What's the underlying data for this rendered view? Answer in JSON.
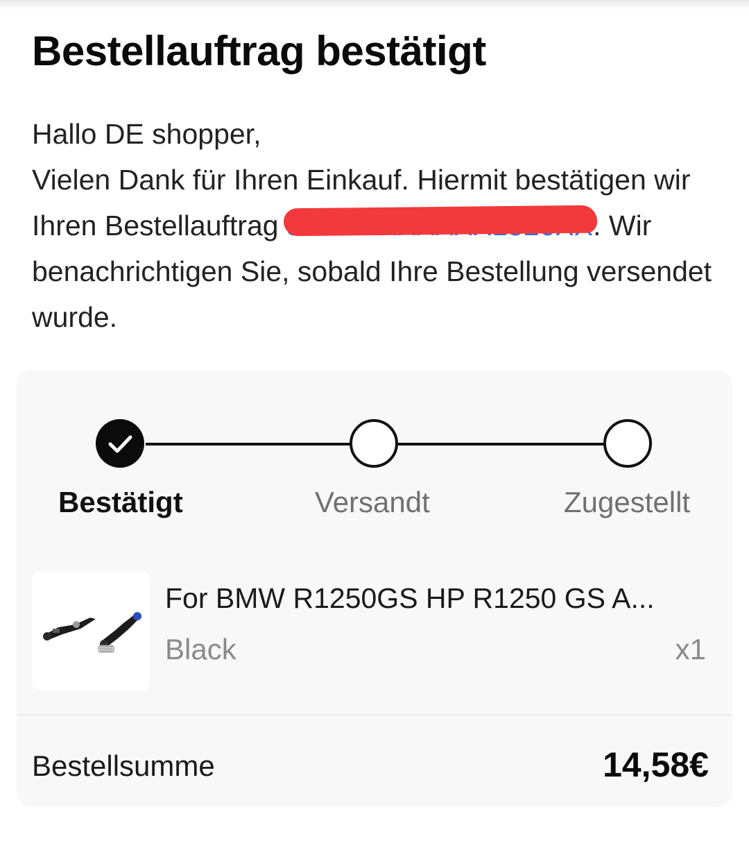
{
  "header": {
    "title": "Bestellauftrag bestätigt"
  },
  "message": {
    "greeting": "Hallo DE shopper,",
    "line_before_order": "Vielen Dank für Ihren Einkauf. Hiermit bestätigen wir Ihren Bestellauftrag ",
    "line_after_order": ". Wir benachrichtigen Sie, sobald Ihre Bestellung versendet wurde."
  },
  "tracker": {
    "steps": [
      {
        "label": "Bestätigt",
        "state": "done"
      },
      {
        "label": "Versandt",
        "state": "pending"
      },
      {
        "label": "Zugestellt",
        "state": "pending"
      }
    ]
  },
  "item": {
    "name": "For BMW R1250GS HP R1250 GS A...",
    "variant": "Black",
    "quantity": "x1"
  },
  "summary": {
    "label": "Bestellsumme",
    "total": "14,58€"
  },
  "colors": {
    "redaction": "#f23a3c",
    "order_link": "#3a6fd8",
    "accent_blue_part": "#2a4fbf"
  },
  "icons": {
    "step_done": "check-icon"
  }
}
